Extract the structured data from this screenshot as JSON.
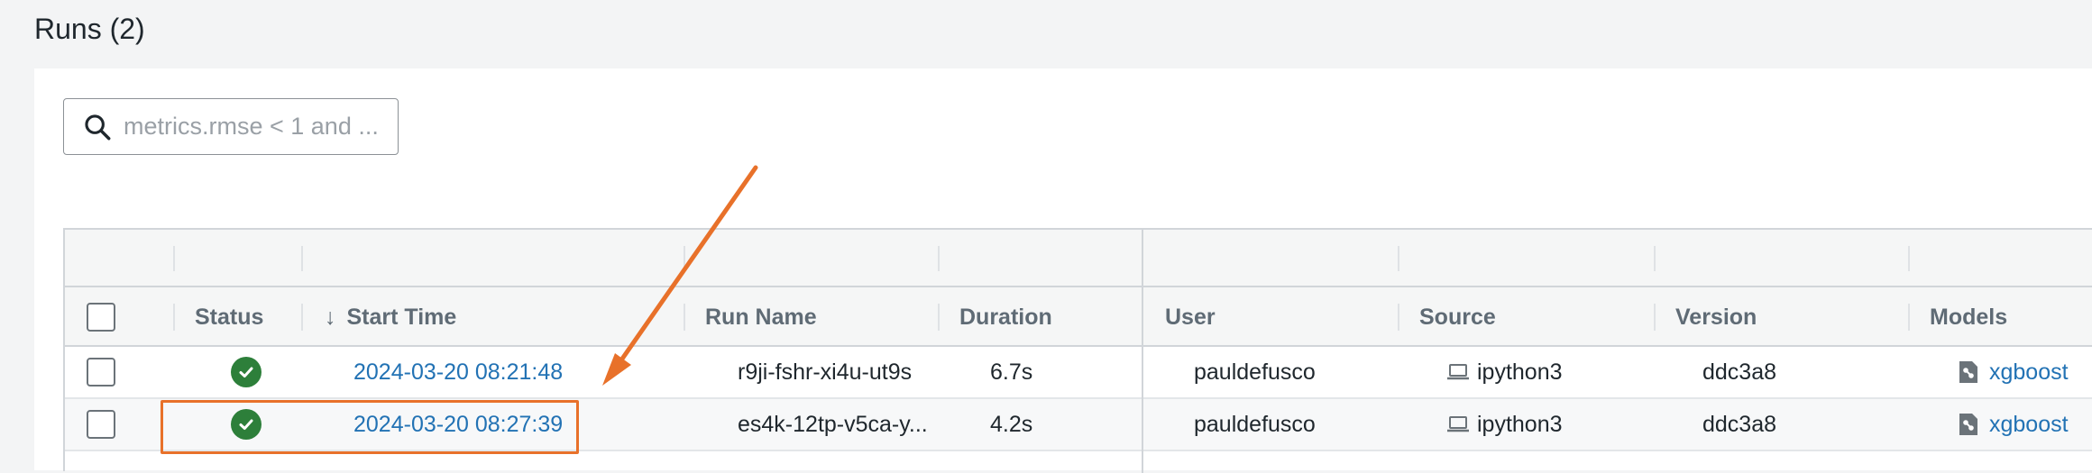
{
  "header": {
    "title": "Runs (2)"
  },
  "search": {
    "placeholder": "metrics.rmse < 1 and ..."
  },
  "columns": {
    "status": "Status",
    "sort_arrow": "↓",
    "start_time": "Start Time",
    "run_name": "Run Name",
    "duration": "Duration",
    "user": "User",
    "source": "Source",
    "version": "Version",
    "models": "Models"
  },
  "rows": [
    {
      "status": "finished",
      "start_time": "2024-03-20 08:21:48",
      "run_name": "r9ji-fshr-xi4u-ut9s",
      "duration": "6.7s",
      "user": "pauldefusco",
      "source": "ipython3",
      "version": "ddc3a8",
      "model": "xgboost"
    },
    {
      "status": "finished",
      "start_time": "2024-03-20 08:27:39",
      "run_name": "es4k-12tp-v5ca-y...",
      "duration": "4.2s",
      "user": "pauldefusco",
      "source": "ipython3",
      "version": "ddc3a8",
      "model": "xgboost"
    }
  ],
  "icons": {
    "search": "search-icon",
    "status": "check-circle-icon",
    "source": "laptop-icon",
    "model": "model-icon",
    "annotation": "arrow-annotation"
  },
  "colors": {
    "accent": "#2272b4",
    "success": "#2d7f3a",
    "annotation": "#e8712a"
  }
}
